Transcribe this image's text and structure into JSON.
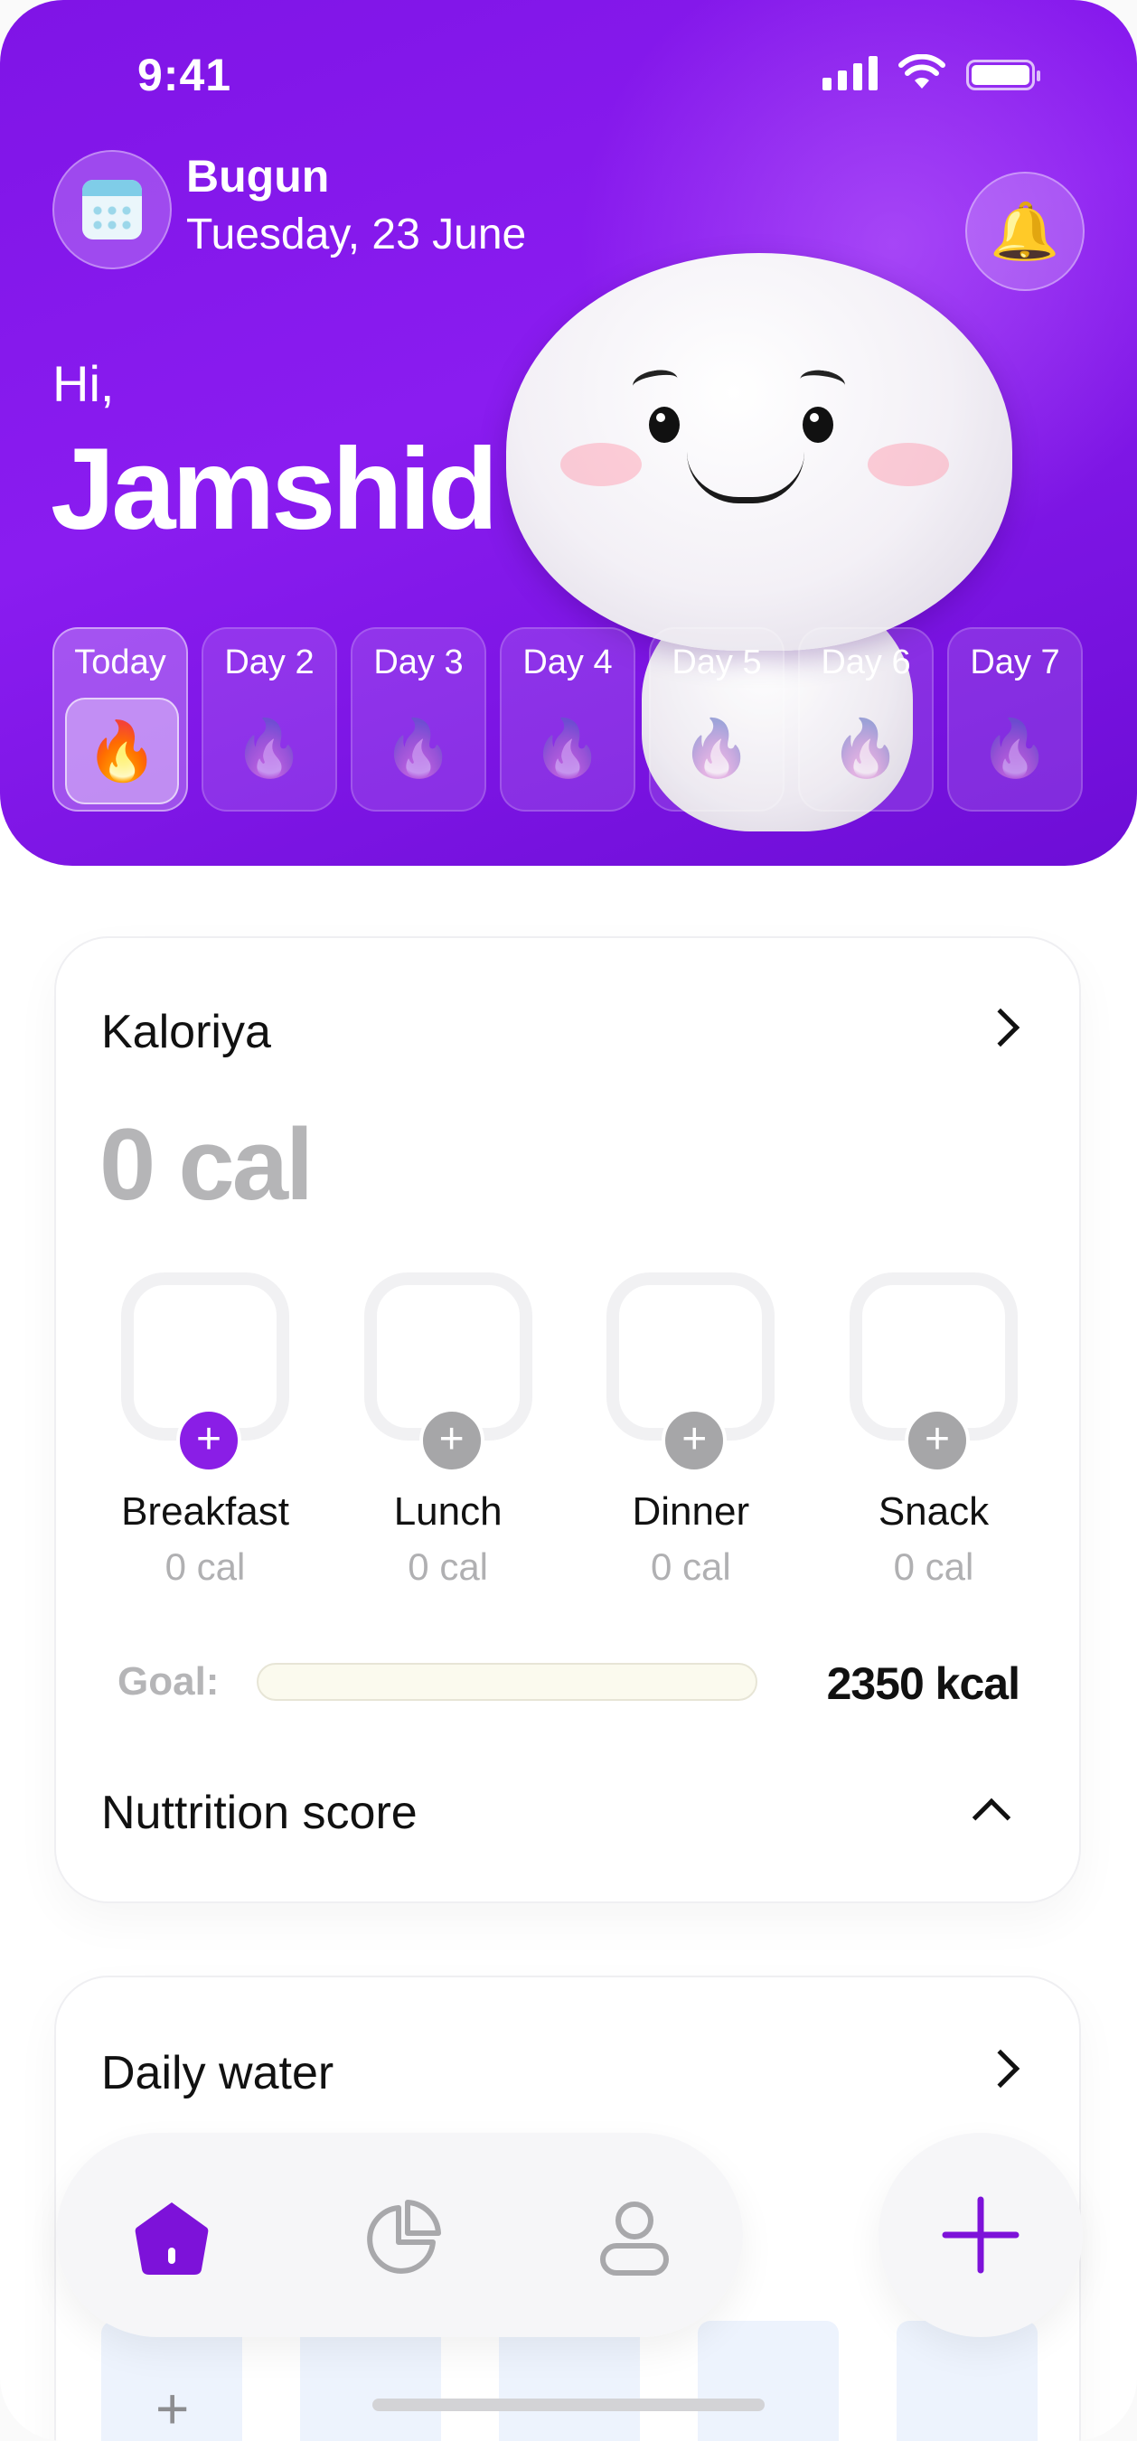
{
  "status_bar": {
    "time": "9:41"
  },
  "header": {
    "label": "Bugun",
    "date": "Tuesday, 23 June",
    "greeting": "Hi,",
    "user_name": "Jamshid"
  },
  "days": [
    {
      "label": "Today",
      "active": true
    },
    {
      "label": "Day 2"
    },
    {
      "label": "Day 3"
    },
    {
      "label": "Day 4"
    },
    {
      "label": "Day 5"
    },
    {
      "label": "Day 6"
    },
    {
      "label": "Day 7"
    }
  ],
  "calories_card": {
    "title": "Kaloriya",
    "total": "0 cal",
    "meals": [
      {
        "name": "Breakfast",
        "cal": "0 cal"
      },
      {
        "name": "Lunch",
        "cal": "0 cal"
      },
      {
        "name": "Dinner",
        "cal": "0 cal"
      },
      {
        "name": "Snack",
        "cal": "0 cal"
      }
    ],
    "goal_label": "Goal:",
    "goal_value": "2350 kcal",
    "goal_progress": 0,
    "nutrition_title": "Nuttrition score"
  },
  "water_card": {
    "title": "Daily water",
    "add_symbol": "+"
  },
  "tab_bar": {
    "tabs": [
      {
        "icon": "home-icon",
        "active": true
      },
      {
        "icon": "pie-chart-icon"
      },
      {
        "icon": "profile-icon"
      }
    ],
    "fab_icon": "plus-icon"
  },
  "colors": {
    "accent": "#8a1ee6",
    "hero_bg": "#7f14e6",
    "muted_text": "#b0b0b2"
  }
}
